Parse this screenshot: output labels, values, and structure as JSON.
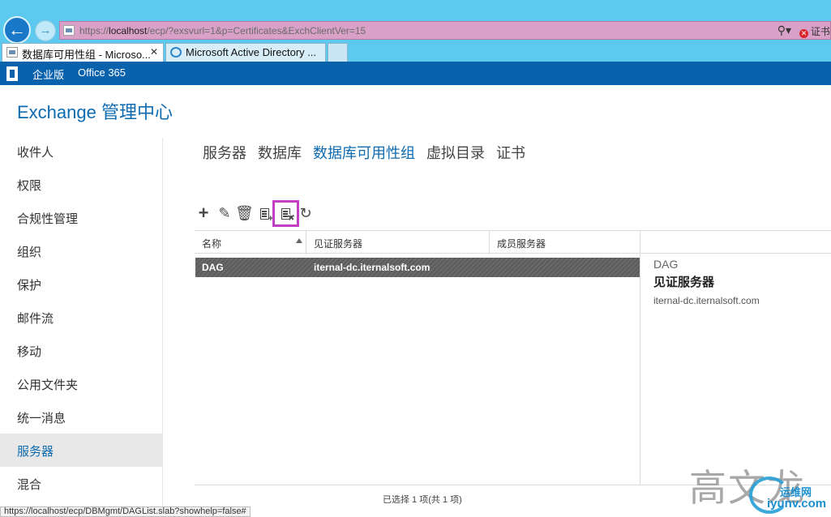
{
  "browser": {
    "address": {
      "scheme": "https://",
      "host": "localhost",
      "path": "/ecp/?exsvurl=1&p=Certificates&ExchClientVer=15"
    },
    "search_glyph": "⚲▾",
    "cert_label": "证书",
    "tabs": [
      {
        "label": "数据库可用性组 - Microso...",
        "close": "✕",
        "icon": "exchange-page-icon"
      },
      {
        "label": "Microsoft Active Directory ...",
        "icon": "ie-icon"
      }
    ],
    "status_url": "https://localhost/ecp/DBMgmt/DAGList.slab?showhelp=false#"
  },
  "office_bar": {
    "enterprise": "企业版",
    "office365": "Office 365"
  },
  "app": {
    "title": "Exchange 管理中心"
  },
  "left_nav": {
    "items": [
      {
        "label": "收件人"
      },
      {
        "label": "权限"
      },
      {
        "label": "合规性管理"
      },
      {
        "label": "组织"
      },
      {
        "label": "保护"
      },
      {
        "label": "邮件流"
      },
      {
        "label": "移动"
      },
      {
        "label": "公用文件夹"
      },
      {
        "label": "统一消息"
      },
      {
        "label": "服务器",
        "active": true
      },
      {
        "label": "混合"
      }
    ]
  },
  "subtabs": [
    {
      "label": "服务器"
    },
    {
      "label": "数据库"
    },
    {
      "label": "数据库可用性组",
      "active": true
    },
    {
      "label": "虚拟目录"
    },
    {
      "label": "证书"
    }
  ],
  "toolbar": {
    "icons": [
      "add-icon",
      "edit-icon",
      "delete-icon",
      "add-server-icon",
      "manage-membership-icon",
      "refresh-icon"
    ]
  },
  "grid": {
    "columns": {
      "name": "名称",
      "witness": "见证服务器",
      "member": "成员服务器"
    },
    "rows": [
      {
        "name": "DAG",
        "witness": "iternal-dc.iternalsoft.com",
        "member": ""
      }
    ],
    "status": "已选择 1 项(共 1 项)"
  },
  "details": {
    "name": "DAG",
    "label": "见证服务器",
    "value": "iternal-dc.iternalsoft.com"
  },
  "watermark": {
    "author": "高文龙",
    "site_cn": "运维网",
    "site": "iyunv.com"
  },
  "colors": {
    "accent": "#0e6bb0",
    "office_bar": "#0a62ad",
    "chrome": "#5ec9ee",
    "highlight_box": "#c23ec6",
    "selected_row": "#636363"
  }
}
